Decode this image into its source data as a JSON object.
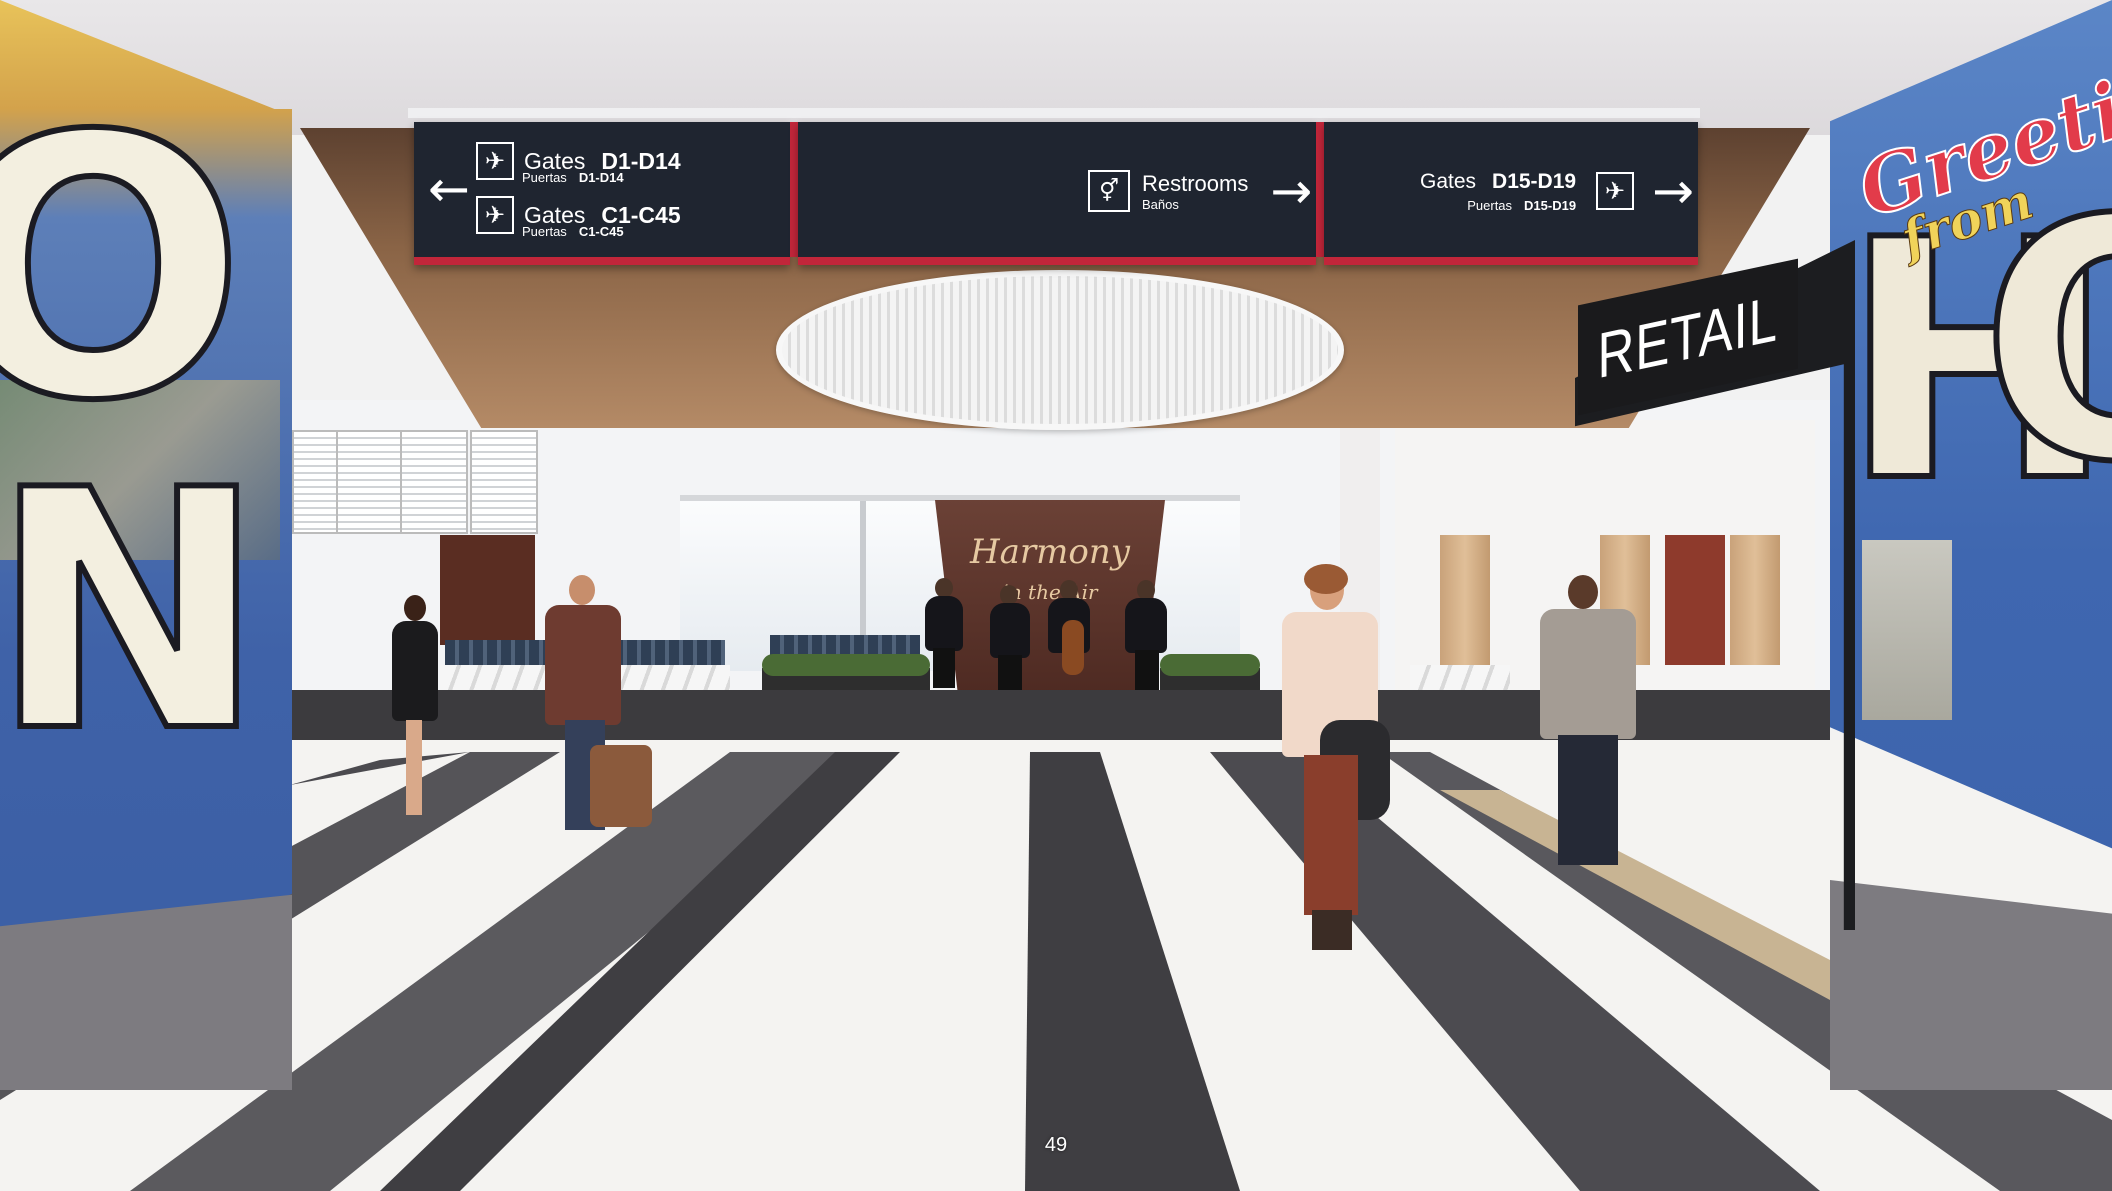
{
  "signage": {
    "left": {
      "row1": {
        "gates": "Gates",
        "range": "D1-D14",
        "puertas": "Puertas",
        "puertas_range": "D1-D14"
      },
      "row2": {
        "gates": "Gates",
        "range": "C1-C45",
        "puertas": "Puertas",
        "puertas_range": "C1-C45"
      },
      "arrow": "←",
      "icon": "airplane-icon"
    },
    "center": {
      "title": "Restrooms",
      "subtitle": "Baños",
      "arrow": "→",
      "icon": "restroom-icon"
    },
    "right": {
      "gates": "Gates",
      "range": "D15-D19",
      "puertas": "Puertas",
      "puertas_range": "D15-D19",
      "arrow": "→",
      "icon": "airplane-icon"
    },
    "colors": {
      "panel": "#1f2530",
      "accent": "#c2263a",
      "text": "#ffffff"
    }
  },
  "retail_sign": "RETAIL",
  "stage_sign": {
    "title": "Harmony",
    "subtitle": "in the Air"
  },
  "mural_left": {
    "letters": [
      "O",
      "N"
    ]
  },
  "mural_right": {
    "script": "Greeti",
    "from": "from",
    "letters": [
      "H",
      "O"
    ]
  },
  "page_number": "49"
}
